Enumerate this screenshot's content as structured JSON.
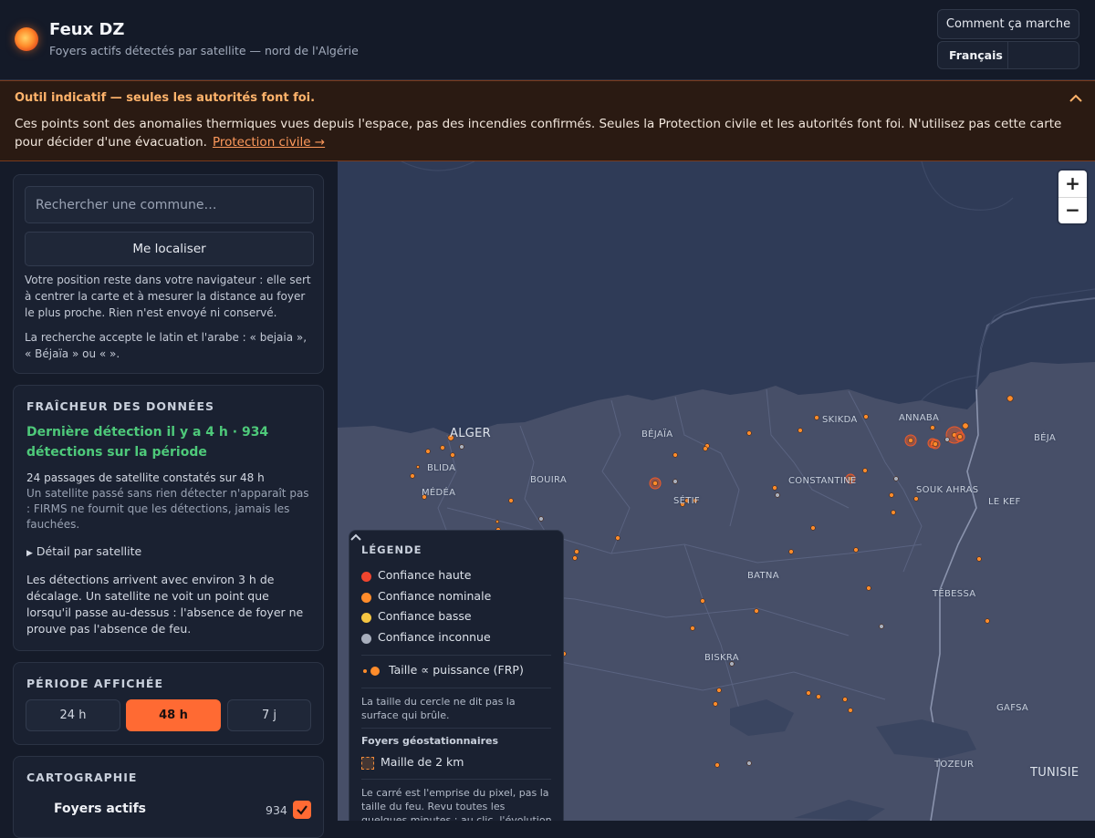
{
  "header": {
    "title": "Feux DZ",
    "subtitle": "Foyers actifs détectés par satellite — nord de l'Algérie",
    "how_label": "Comment ça marche",
    "language": "Français"
  },
  "banner": {
    "title": "Outil indicatif — seules les autorités font foi.",
    "text": "Ces points sont des anomalies thermiques vues depuis l'espace, pas des incendies confirmés. Seules la Protection civile et les autorités font foi. N'utilisez pas cette carte pour décider d'une évacuation.",
    "link": "Protection civile →"
  },
  "search": {
    "placeholder": "Rechercher une commune…",
    "locate_label": "Me localiser",
    "privacy_note": "Votre position reste dans votre navigateur : elle sert à centrer la carte et à mesurer la distance au foyer le plus proche. Rien n'est envoyé ni conservé.",
    "script_note": "La recherche accepte le latin et l'arabe : « bejaia », « Béjaïa » ou «             »."
  },
  "freshness": {
    "title": "FRAÎCHEUR DES DONNÉES",
    "last_detection": "Dernière détection il y a 4 h · 934 détections sur la période",
    "passes": "24 passages de satellite constatés sur 48 h",
    "passes_note": "Un satellite passé sans rien détecter n'apparaît pas : FIRMS ne fournit que les détections, jamais les fauchées.",
    "details_label": "Détail par satellite",
    "delay_note": "Les détections arrivent avec environ 3 h de décalage. Un satellite ne voit un point que lorsqu'il passe au-dessus : l'absence de foyer ne prouve pas l'absence de feu."
  },
  "period": {
    "title": "PÉRIODE AFFICHÉE",
    "options": [
      "24 h",
      "48 h",
      "7 j"
    ],
    "selected": "48 h"
  },
  "cartography": {
    "title": "CARTOGRAPHIE",
    "layer_label": "Foyers actifs",
    "layer_count": "934",
    "layer_checked": true
  },
  "map": {
    "zoom_in": "+",
    "zoom_out": "−",
    "places": {
      "alger": "ALGER",
      "blida": "BLIDA",
      "medea": "MÉDÉA",
      "bejaia": "BÉJAÏA",
      "bouira": "BOUIRA",
      "setif": "SÉTIF",
      "skikda": "SKIKDA",
      "annaba": "ANNABA",
      "constantine": "CONSTANTINE",
      "souk_ahras": "SOUK AHRAS",
      "beja": "BÉJA",
      "le_kef": "LE KEF",
      "batna": "BATNA",
      "tebessa": "TÉBESSA",
      "biskra": "BISKRA",
      "gafsa": "GAFSA",
      "tozeur": "TOZEUR",
      "tunisie": "TUNISIE"
    }
  },
  "legend": {
    "title": "LÉGENDE",
    "items": [
      {
        "label": "Confiance haute",
        "color": "#f0452e"
      },
      {
        "label": "Confiance nominale",
        "color": "#ff8c2b"
      },
      {
        "label": "Confiance basse",
        "color": "#f5c542"
      },
      {
        "label": "Confiance inconnue",
        "color": "#a8afbd"
      }
    ],
    "size_label": "Taille ∝ puissance (FRP)",
    "size_note": "La taille du cercle ne dit pas la surface qui brûle.",
    "geo_title": "Foyers géostationnaires",
    "cell_label": "Maille de 2 km",
    "cell_note": "Le carré est l'emprise du pixel, pas la taille du feu. Revu toutes les quelques minutes ; au clic, l'évolution de la"
  }
}
